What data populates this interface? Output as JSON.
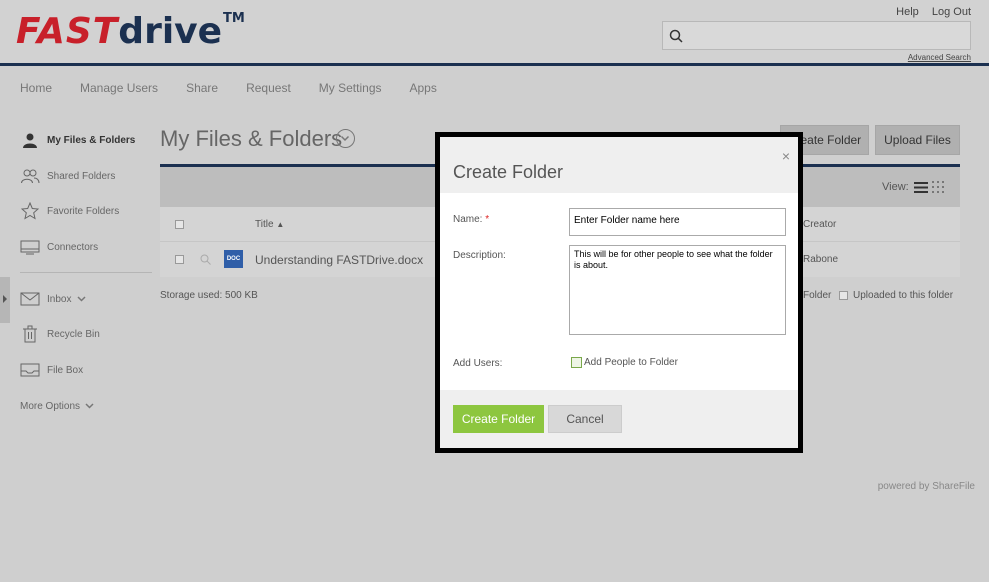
{
  "header": {
    "logo_fast": "FAST",
    "logo_drive": "drive",
    "logo_tm": "TM",
    "help": "Help",
    "logout": "Log Out",
    "advanced_search": "Advanced Search",
    "search_placeholder": ""
  },
  "nav": [
    "Home",
    "Manage Users",
    "Share",
    "Request",
    "My Settings",
    "Apps"
  ],
  "sidebar": {
    "items": [
      {
        "label": "My Files & Folders",
        "icon": "person-icon"
      },
      {
        "label": "Shared Folders",
        "icon": "people-icon"
      },
      {
        "label": "Favorite Folders",
        "icon": "star-icon"
      },
      {
        "label": "Connectors",
        "icon": "connector-icon"
      },
      {
        "label": "Inbox",
        "icon": "mail-icon"
      },
      {
        "label": "Recycle Bin",
        "icon": "trash-icon"
      },
      {
        "label": "File Box",
        "icon": "filebox-icon"
      },
      {
        "label": "More Options",
        "icon": "chevron-down-icon"
      }
    ]
  },
  "main": {
    "title": "My Files & Folders",
    "create_folder_btn": "Create Folder",
    "upload_btn": "Upload Files",
    "view_label": "View:",
    "col_title": "Title",
    "col_creator": "Creator",
    "row": {
      "type": "DOC",
      "title": "Understanding FASTDrive.docx",
      "creator": "Rabone"
    },
    "storage": "Storage used: 500 KB",
    "filter_folder": "Folder",
    "filter_uploaded": "Uploaded to this folder",
    "powered": "powered by ShareFile"
  },
  "modal": {
    "title": "Create Folder",
    "close": "×",
    "name_label": "Name:",
    "required_mark": "*",
    "name_value": "Enter Folder name here",
    "description_label": "Description:",
    "description_value": "This will be for other people to see what the folder is about.",
    "add_users_label": "Add Users:",
    "add_people": "Add People to Folder",
    "create_btn": "Create Folder",
    "cancel_btn": "Cancel"
  }
}
